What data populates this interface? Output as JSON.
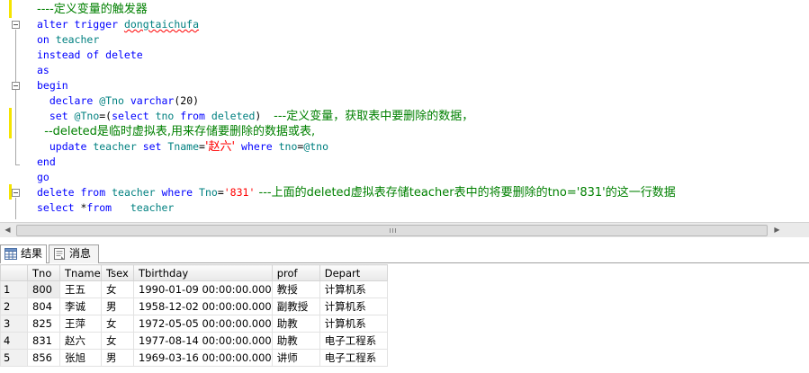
{
  "code_lines": [
    {
      "line_no": 1,
      "spans": [
        {
          "t": "----定义变量的触发器",
          "c": "cm"
        }
      ]
    },
    {
      "line_no": 2,
      "spans": [
        {
          "t": "alter trigger ",
          "c": "kw"
        },
        {
          "t": "dongtaichufa",
          "c": "id err"
        }
      ]
    },
    {
      "line_no": 3,
      "spans": [
        {
          "t": "on ",
          "c": "kw"
        },
        {
          "t": "teacher",
          "c": "id"
        }
      ]
    },
    {
      "line_no": 4,
      "spans": [
        {
          "t": "instead of delete",
          "c": "kw"
        }
      ]
    },
    {
      "line_no": 5,
      "spans": [
        {
          "t": "as",
          "c": "kw"
        }
      ]
    },
    {
      "line_no": 6,
      "spans": [
        {
          "t": "begin",
          "c": "kw"
        }
      ]
    },
    {
      "line_no": 7,
      "spans": [
        {
          "t": "  declare ",
          "c": "kw"
        },
        {
          "t": "@Tno ",
          "c": "id"
        },
        {
          "t": "varchar",
          "c": "kw"
        },
        {
          "t": "(20)",
          "c": "pl"
        }
      ]
    },
    {
      "line_no": 8,
      "spans": [
        {
          "t": "  set ",
          "c": "kw"
        },
        {
          "t": "@Tno",
          "c": "id"
        },
        {
          "t": "=(",
          "c": "pl"
        },
        {
          "t": "select ",
          "c": "kw"
        },
        {
          "t": "tno ",
          "c": "id"
        },
        {
          "t": "from ",
          "c": "kw"
        },
        {
          "t": "deleted",
          "c": "id"
        },
        {
          "t": ")  ",
          "c": "pl"
        },
        {
          "t": "---定义变量，获取表中要删除的数据，",
          "c": "cm"
        }
      ]
    },
    {
      "line_no": 9,
      "spans": [
        {
          "t": "  --deleted是临时虚拟表,用来存储要删除的数据或表,",
          "c": "cm"
        }
      ]
    },
    {
      "line_no": 10,
      "spans": [
        {
          "t": "  update ",
          "c": "kw"
        },
        {
          "t": "teacher ",
          "c": "id"
        },
        {
          "t": "set ",
          "c": "kw"
        },
        {
          "t": "Tname",
          "c": "id"
        },
        {
          "t": "=",
          "c": "pl"
        },
        {
          "t": "'赵六'",
          "c": "str"
        },
        {
          "t": " where ",
          "c": "kw"
        },
        {
          "t": "tno",
          "c": "id"
        },
        {
          "t": "=",
          "c": "pl"
        },
        {
          "t": "@tno",
          "c": "id"
        }
      ]
    },
    {
      "line_no": 11,
      "spans": [
        {
          "t": "end",
          "c": "kw"
        }
      ]
    },
    {
      "line_no": 12,
      "spans": [
        {
          "t": "go",
          "c": "kw"
        }
      ]
    },
    {
      "line_no": 13,
      "spans": [
        {
          "t": "delete from ",
          "c": "kw"
        },
        {
          "t": "teacher ",
          "c": "id"
        },
        {
          "t": "where ",
          "c": "kw"
        },
        {
          "t": "Tno",
          "c": "id"
        },
        {
          "t": "=",
          "c": "pl"
        },
        {
          "t": "'831'",
          "c": "str"
        },
        {
          "t": " ---上面的deleted虚拟表存储teacher表中的将要删除的tno='831'的这一行数据",
          "c": "cm"
        }
      ]
    },
    {
      "line_no": 14,
      "spans": [
        {
          "t": "select ",
          "c": "kw"
        },
        {
          "t": "*",
          "c": "pl"
        },
        {
          "t": "from",
          "c": "kw"
        },
        {
          "t": "   teacher",
          "c": "id"
        }
      ]
    }
  ],
  "tabs": [
    {
      "label": "结果",
      "icon": "grid-results-icon",
      "active": true
    },
    {
      "label": "消息",
      "icon": "messages-icon",
      "active": false
    }
  ],
  "results": {
    "columns": [
      "Tno",
      "Tname",
      "Tsex",
      "Tbirthday",
      "prof",
      "Depart"
    ],
    "rows": [
      {
        "row_no": "1",
        "cells": [
          "800",
          "王五",
          "女",
          "1990-01-09 00:00:00.000",
          "教授",
          "计算机系"
        ]
      },
      {
        "row_no": "2",
        "cells": [
          "804",
          "李诚",
          "男",
          "1958-12-02 00:00:00.000",
          "副教授",
          "计算机系"
        ]
      },
      {
        "row_no": "3",
        "cells": [
          "825",
          "王萍",
          "女",
          "1972-05-05 00:00:00.000",
          "助教",
          "计算机系"
        ]
      },
      {
        "row_no": "4",
        "cells": [
          "831",
          "赵六",
          "女",
          "1977-08-14 00:00:00.000",
          "助教",
          "电子工程系"
        ]
      },
      {
        "row_no": "5",
        "cells": [
          "856",
          "张旭",
          "男",
          "1969-03-16 00:00:00.000",
          "讲师",
          "电子工程系"
        ]
      }
    ]
  },
  "colors": {
    "keyword": "#0000ff",
    "identifier": "#008080",
    "string": "#ff0000",
    "comment": "#008000",
    "change_marker": "#f5e400"
  }
}
